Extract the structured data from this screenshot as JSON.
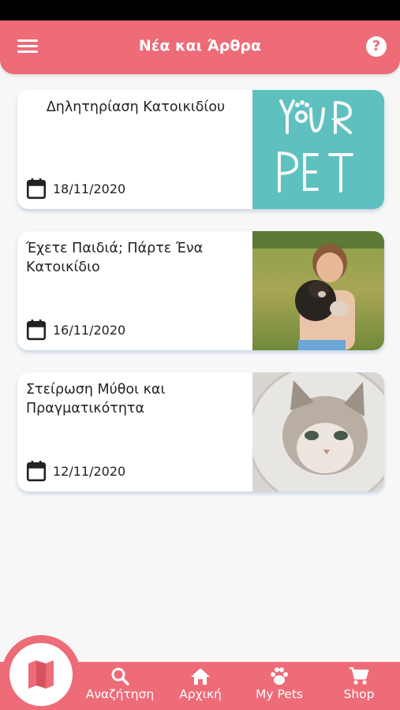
{
  "header": {
    "title": "Νέα και Άρθρα",
    "help_label": "?"
  },
  "articles": [
    {
      "title": "Δηλητηρίαση Κατοικιδίου",
      "date": "18/11/2020",
      "image": "your-pet-logo"
    },
    {
      "title": "Έχετε Παιδιά; Πάρτε Ένα Κατοικίδιο",
      "date": "16/11/2020",
      "image": "girl-with-puppy"
    },
    {
      "title": "Στείρωση Μύθοι και Πραγματικότητα",
      "date": "12/11/2020",
      "image": "cat-with-cone"
    }
  ],
  "bottom_nav": {
    "map_icon": "map-icon",
    "items": [
      {
        "label": "Αναζήτηση",
        "icon": "search-icon"
      },
      {
        "label": "Αρχική",
        "icon": "home-icon"
      },
      {
        "label": "My Pets",
        "icon": "paw-icon"
      },
      {
        "label": "Shop",
        "icon": "cart-icon"
      }
    ]
  },
  "colors": {
    "accent": "#ee6b78",
    "background": "#f7f7f7",
    "your_pet_teal": "#5fc0c0"
  }
}
